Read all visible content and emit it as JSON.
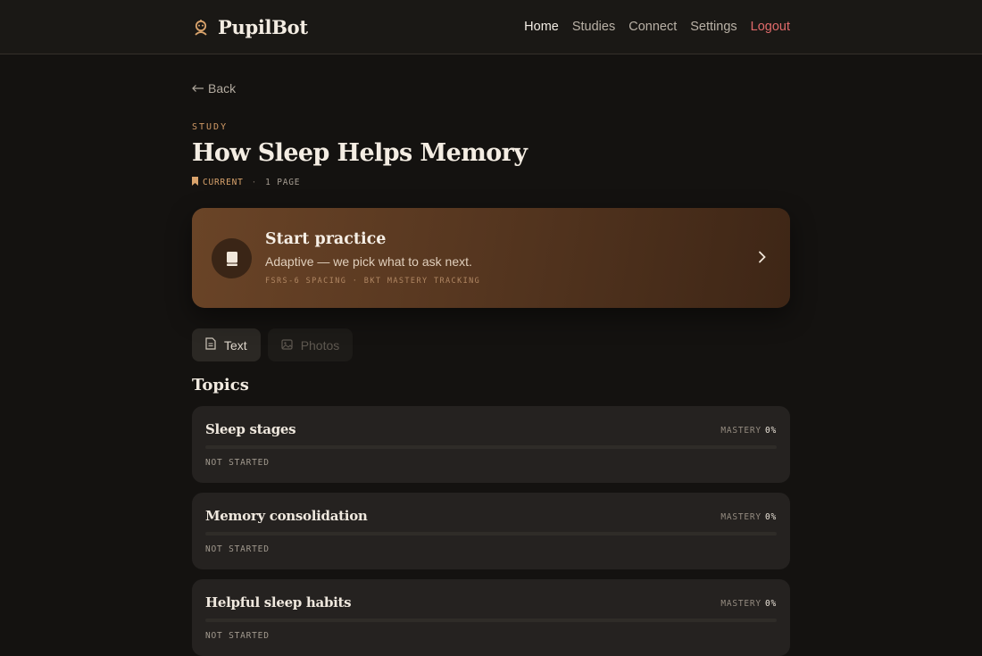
{
  "header": {
    "app_name": "PupilBot",
    "logo_icon": "robot-icon",
    "nav": [
      {
        "label": "Home",
        "active": true
      },
      {
        "label": "Studies",
        "active": false
      },
      {
        "label": "Connect",
        "active": false
      },
      {
        "label": "Settings",
        "active": false
      },
      {
        "label": "Logout",
        "active": false
      }
    ]
  },
  "main": {
    "back_label": "Back",
    "eyebrow": "STUDY",
    "title": "How Sleep Helps Memory",
    "meta": {
      "status": "CURRENT",
      "pages": "1 PAGE"
    },
    "practice": {
      "title": "Start practice",
      "subtitle": "Adaptive — we pick what to ask next.",
      "tags": "FSRS-6 SPACING · BKT MASTERY TRACKING",
      "icon": "book-icon"
    },
    "tabs": [
      {
        "label": "Text",
        "icon": "document-icon",
        "active": true
      },
      {
        "label": "Photos",
        "icon": "image-icon",
        "active": false
      }
    ],
    "topics_title": "Topics",
    "topics": [
      {
        "name": "Sleep stages",
        "mastery_label": "MASTERY",
        "mastery_value": "0%",
        "mastery_fraction": 0,
        "status": "NOT STARTED"
      },
      {
        "name": "Memory consolidation",
        "mastery_label": "MASTERY",
        "mastery_value": "0%",
        "mastery_fraction": 0,
        "status": "NOT STARTED"
      },
      {
        "name": "Helpful sleep habits",
        "mastery_label": "MASTERY",
        "mastery_value": "0%",
        "mastery_fraction": 0,
        "status": "NOT STARTED"
      }
    ]
  },
  "colors": {
    "background": "#141210",
    "accent": "#d19a66",
    "logout": "#e06a6a",
    "card": "#252220"
  }
}
